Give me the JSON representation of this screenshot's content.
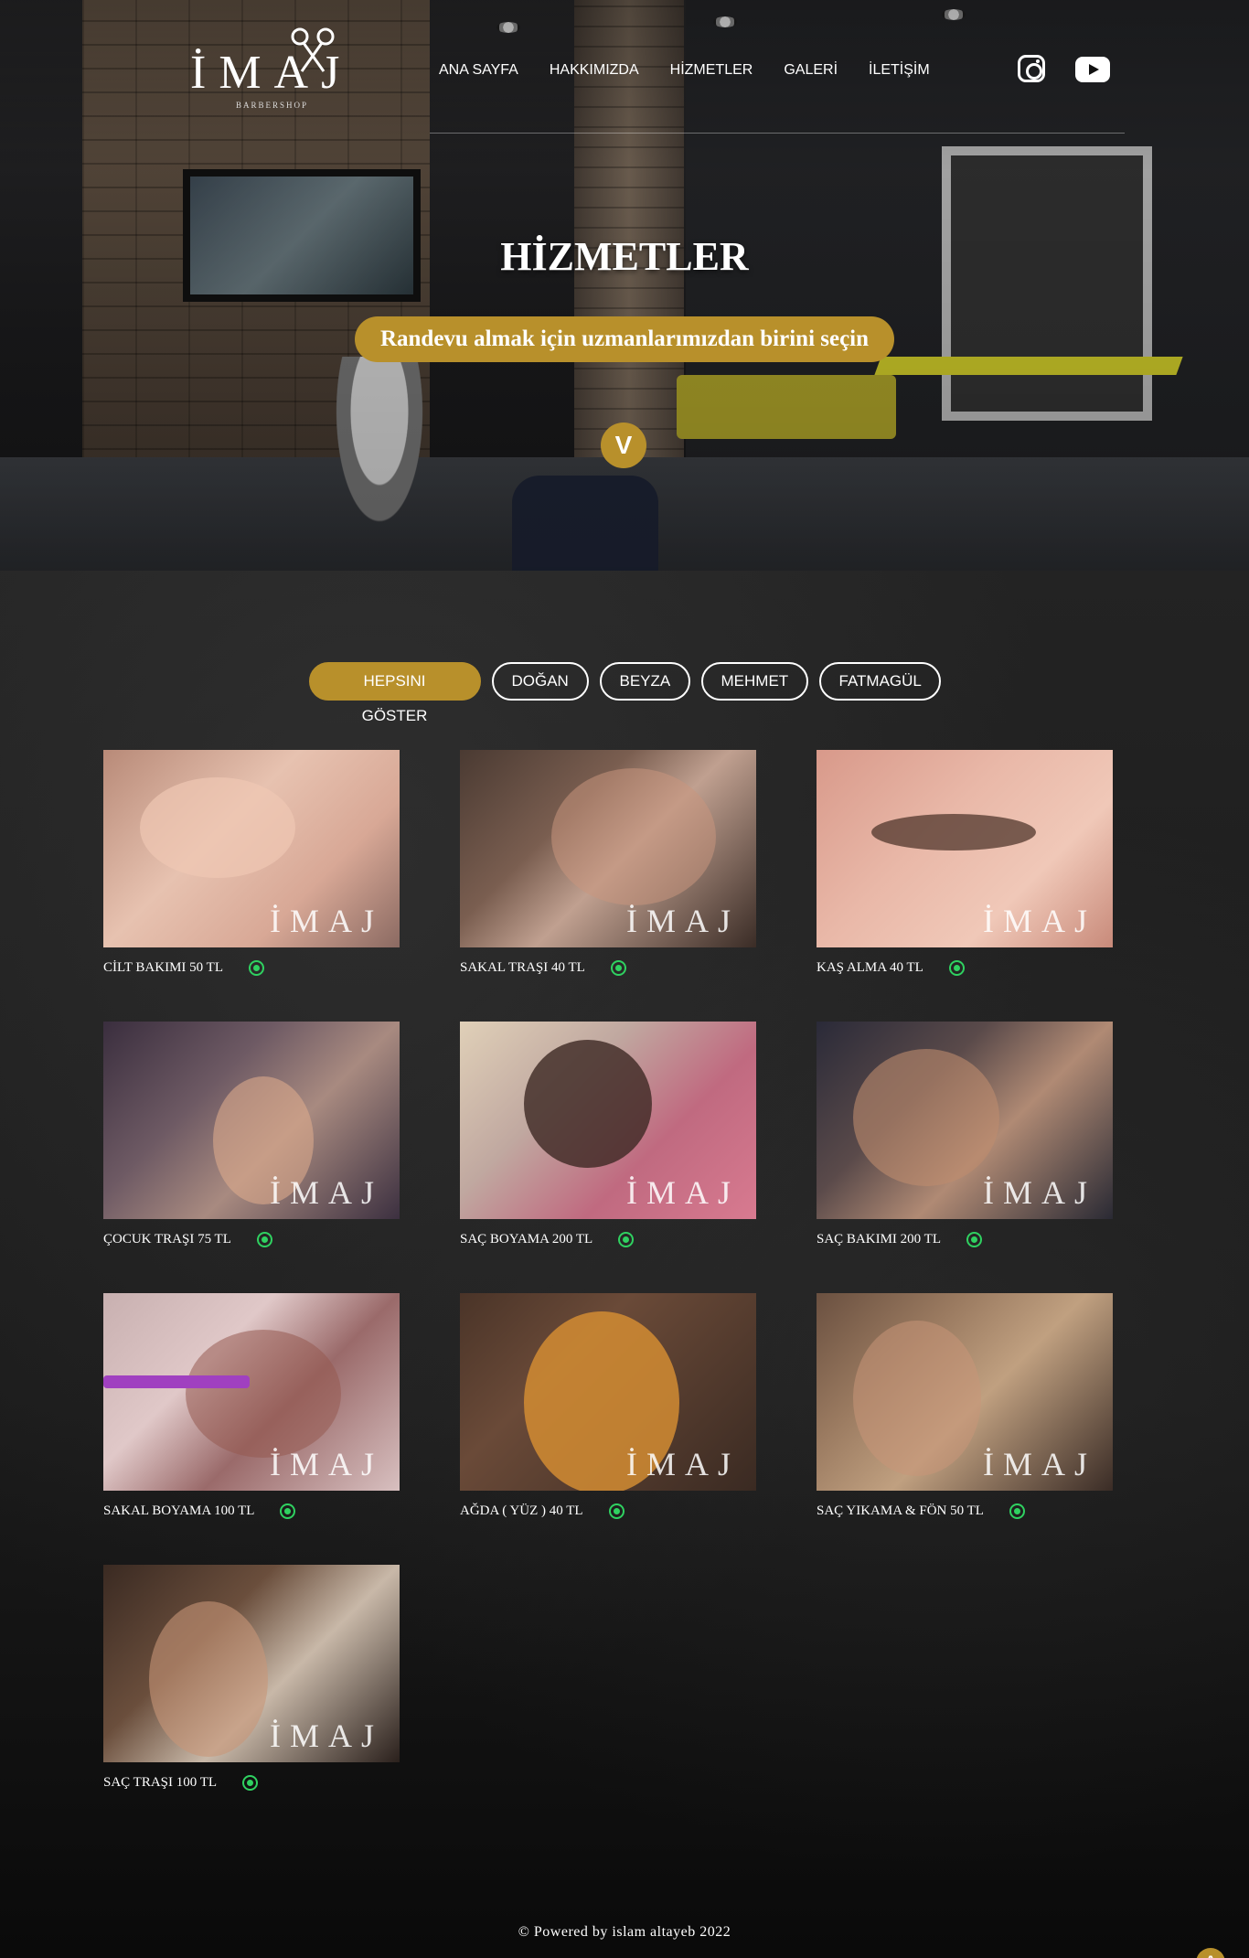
{
  "header": {
    "logo_text": "İMAJ",
    "logo_sub": "BARBERSHOP",
    "nav": [
      "ANA SAYFA",
      "HAKKIMIZDA",
      "HİZMETLER",
      "GALERİ",
      "İLETİŞİM"
    ],
    "social": [
      "instagram-icon",
      "youtube-icon"
    ]
  },
  "hero": {
    "title": "HİZMETLER",
    "subtitle": "Randevu almak için uzmanlarımızdan birini seçin",
    "scroll_label": "V"
  },
  "filters": [
    "HEPSINI GÖSTER",
    "DOĞAN",
    "BEYZA",
    "MEHMET",
    "FATMAGÜL"
  ],
  "services": [
    {
      "label": "CİLT BAKIMI 50 TL"
    },
    {
      "label": "SAKAL TRAŞI 40 TL"
    },
    {
      "label": "KAŞ ALMA 40 TL"
    },
    {
      "label": "ÇOCUK TRAŞI 75 TL"
    },
    {
      "label": "SAÇ BOYAMA 200 TL"
    },
    {
      "label": "SAÇ BAKIMI 200 TL"
    },
    {
      "label": "SAKAL BOYAMA 100 TL"
    },
    {
      "label": "AĞDA ( YÜZ ) 40 TL"
    },
    {
      "label": "SAÇ YIKAMA & FÖN 50 TL"
    },
    {
      "label": "SAÇ TRAŞI 100 TL"
    }
  ],
  "footer": {
    "text": "© Powered by islam altayeb 2022",
    "to_top": "^"
  },
  "colors": {
    "accent": "#b8902b",
    "whatsapp": "#2fd160",
    "background": "#1b1b1b"
  }
}
